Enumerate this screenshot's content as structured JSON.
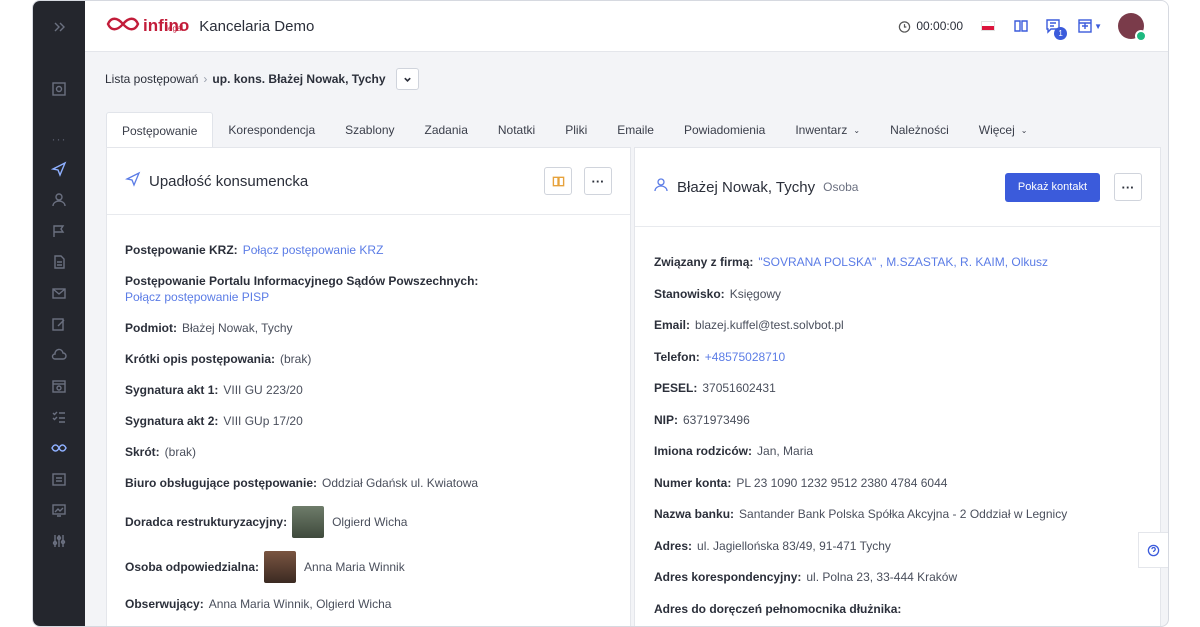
{
  "header": {
    "logo_text": "infino",
    "logo_sub": "legal",
    "title": "Kancelaria Demo",
    "timer": "00:00:00",
    "notification_count": "1"
  },
  "breadcrumb": {
    "root": "Lista postępowań",
    "current": "up. kons. Błażej Nowak, Tychy"
  },
  "tabs": [
    {
      "label": "Postępowanie"
    },
    {
      "label": "Korespondencja"
    },
    {
      "label": "Szablony"
    },
    {
      "label": "Zadania"
    },
    {
      "label": "Notatki"
    },
    {
      "label": "Pliki"
    },
    {
      "label": "Emaile"
    },
    {
      "label": "Powiadomienia"
    },
    {
      "label": "Inwentarz"
    },
    {
      "label": "Należności"
    },
    {
      "label": "Więcej"
    }
  ],
  "left_panel": {
    "title": "Upadłość konsumencka",
    "fields": {
      "krz_label": "Postępowanie KRZ:",
      "krz_value": "Połącz postępowanie KRZ",
      "pisp_label": "Postępowanie Portalu Informacyjnego Sądów Powszechnych:",
      "pisp_value": "Połącz postępowanie PISP",
      "podmiot_label": "Podmiot:",
      "podmiot_value": "Błażej Nowak, Tychy",
      "opis_label": "Krótki opis postępowania:",
      "opis_value": "(brak)",
      "sygn1_label": "Sygnatura akt 1:",
      "sygn1_value": "VIII GU 223/20",
      "sygn2_label": "Sygnatura akt 2:",
      "sygn2_value": "VIII GUp 17/20",
      "skrot_label": "Skrót:",
      "skrot_value": "(brak)",
      "biuro_label": "Biuro obsługujące postępowanie:",
      "biuro_value": "Oddział Gdańsk ul. Kwiatowa",
      "doradca_label": "Doradca restrukturyzacyjny:",
      "doradca_value": "Olgierd Wicha",
      "osoba_label": "Osoba odpowiedzialna:",
      "osoba_value": "Anna Maria Winnik",
      "obserwujacy_label": "Obserwujący:",
      "obserwujacy_value": "Anna Maria Winnik, Olgierd Wicha"
    }
  },
  "right_panel": {
    "title": "Błażej Nowak, Tychy",
    "subtitle": "Osoba",
    "button_label": "Pokaż kontakt",
    "fields": {
      "firma_label": "Związany z firmą:",
      "firma_value": "\"SOVRANA POLSKA\" , M.SZASTAK, R. KAIM, Olkusz",
      "stanowisko_label": "Stanowisko:",
      "stanowisko_value": "Księgowy",
      "email_label": "Email:",
      "email_value": "blazej.kuffel@test.solvbot.pl",
      "telefon_label": "Telefon:",
      "telefon_value": "+48575028710",
      "pesel_label": "PESEL:",
      "pesel_value": "37051602431",
      "nip_label": "NIP:",
      "nip_value": "6371973496",
      "rodzice_label": "Imiona rodziców:",
      "rodzice_value": "Jan, Maria",
      "konto_label": "Numer konta:",
      "konto_value": "PL 23 1090 1232 9512 2380 4784 6044",
      "bank_label": "Nazwa banku:",
      "bank_value": "Santander Bank Polska Spółka Akcyjna - 2 Oddział w Legnicy",
      "adres_label": "Adres:",
      "adres_value": "ul. Jagiellońska 83/49, 91-471 Tychy",
      "koresp_label": "Adres korespondencyjny:",
      "koresp_value": "ul. Polna 23, 33-444 Kraków",
      "doreczenia_label": "Adres do doręczeń pełnomocnika dłużnika:"
    }
  }
}
